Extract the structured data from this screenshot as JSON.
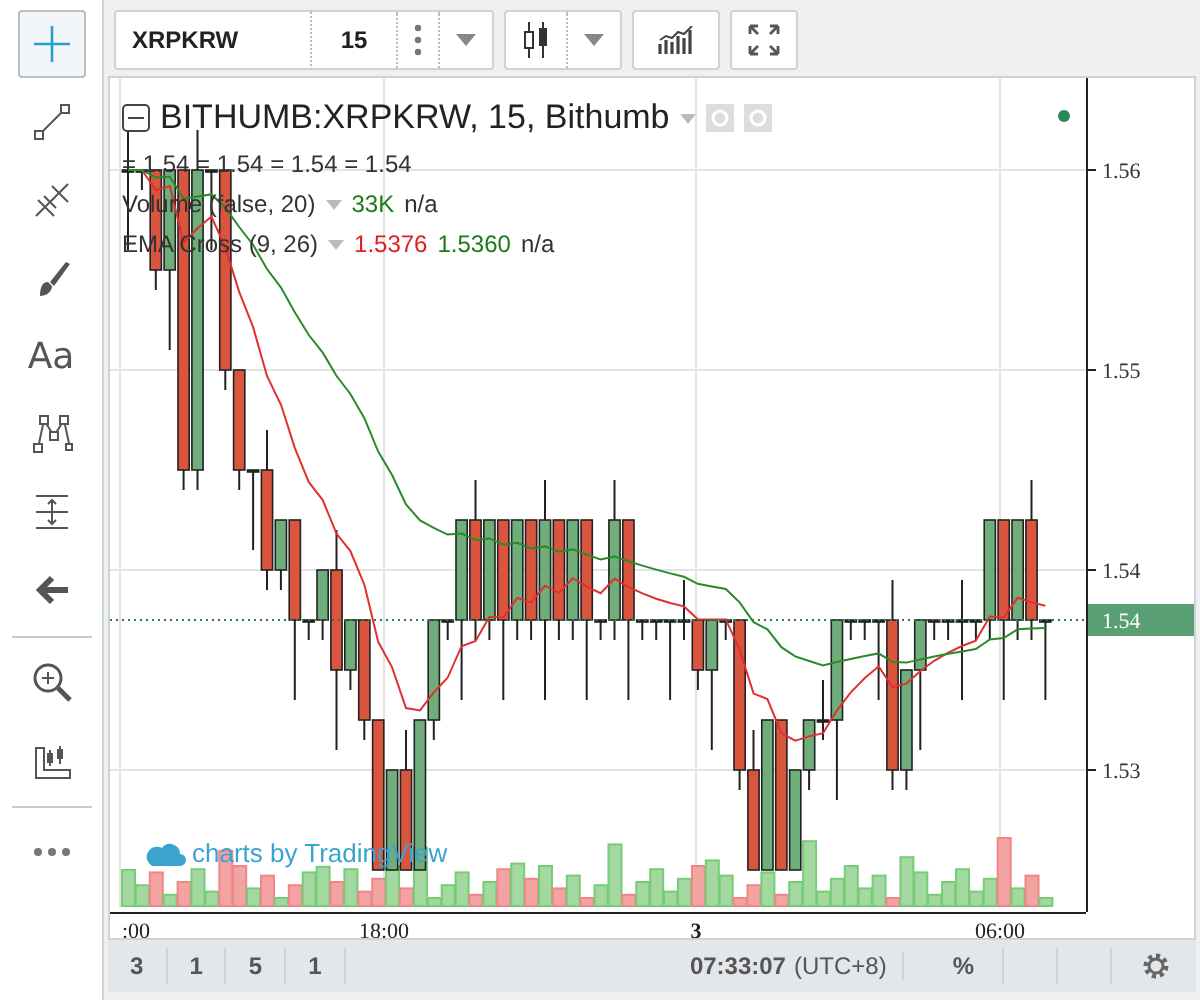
{
  "left_toolbar": {
    "tools": [
      {
        "kind": "crosshair",
        "selected": true
      },
      {
        "kind": "trend-line",
        "selected": false
      },
      {
        "kind": "pitchfork",
        "selected": false
      },
      {
        "kind": "brush",
        "selected": false
      },
      {
        "kind": "text",
        "label": "Aa",
        "selected": false
      },
      {
        "kind": "pattern",
        "selected": false
      },
      {
        "kind": "measure",
        "selected": false
      },
      {
        "kind": "back",
        "selected": false
      },
      {
        "kind": "zoom",
        "selected": false
      },
      {
        "kind": "ruler",
        "selected": false
      },
      {
        "kind": "more",
        "selected": false
      }
    ]
  },
  "top_toolbar": {
    "symbol": "XRPKRW",
    "interval": "15"
  },
  "legend": {
    "title": "BITHUMB:XRPKRW, 15, Bithumb",
    "ohlc": "= 1.54 = 1.54 = 1.54 = 1.54",
    "indicators": [
      {
        "name": "Volume (false, 20)",
        "values": [
          {
            "text": "33K",
            "color": "#1a7a1a"
          },
          {
            "text": "n/a",
            "color": "#333333"
          }
        ]
      },
      {
        "name": "EMA Cross (9, 26)",
        "values": [
          {
            "text": "1.5376",
            "color": "#e02020"
          },
          {
            "text": "1.5360",
            "color": "#1a7a1a"
          },
          {
            "text": "n/a",
            "color": "#333333"
          }
        ]
      }
    ]
  },
  "price_axis": {
    "ticks": [
      "1.56",
      "1.55",
      "1.54",
      "1.53"
    ],
    "current_price": "1.54"
  },
  "time_axis": {
    "ticks": [
      {
        "label": ":00",
        "bold": false
      },
      {
        "label": "18:00",
        "bold": false
      },
      {
        "label": "3",
        "bold": true
      },
      {
        "label": "06:00",
        "bold": false
      }
    ]
  },
  "branding": "charts by TradingView",
  "bottom_bar": {
    "ranges": [
      "3",
      "1",
      "5",
      "1"
    ],
    "clock": "07:33:07",
    "timezone": "(UTC+8)",
    "percent": "%"
  }
}
